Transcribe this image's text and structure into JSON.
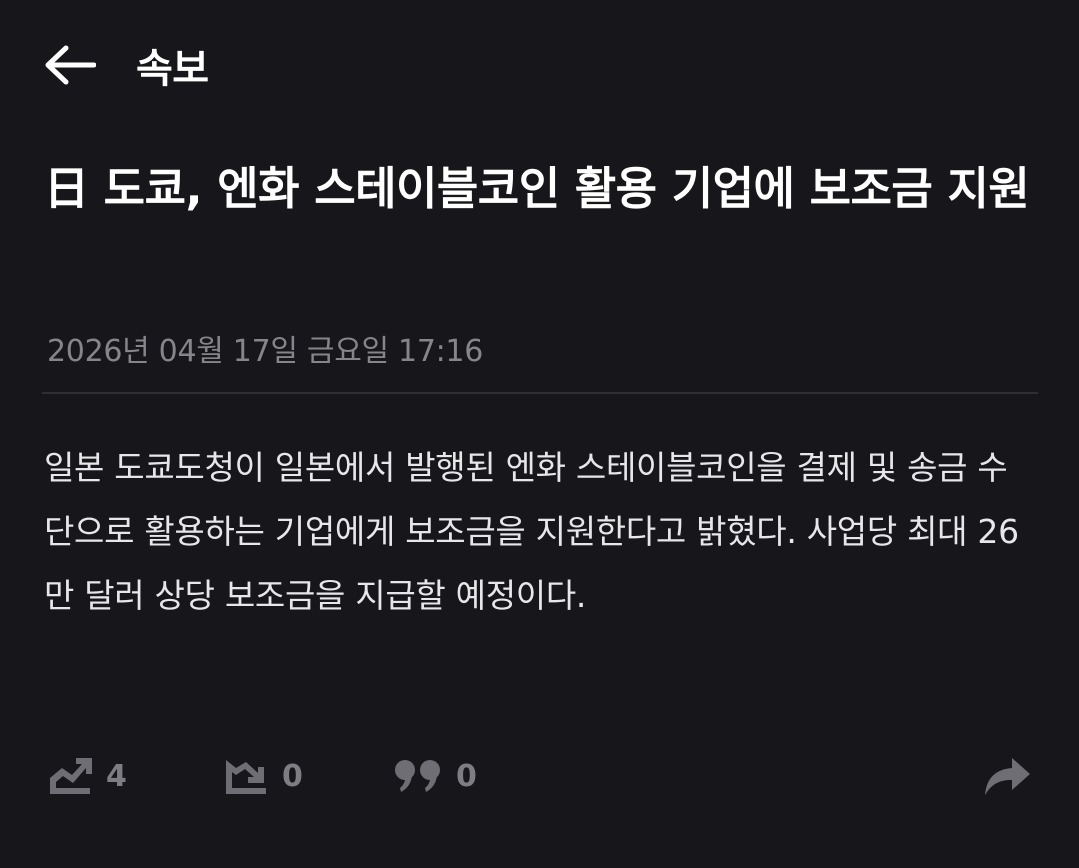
{
  "header": {
    "title": "속보"
  },
  "article": {
    "title": "日 도쿄, 엔화 스테이블코인 활용 기업에 보조금 지원",
    "date": "2026년 04월 17일 금요일 17:16",
    "body": "일본 도쿄도청이 일본에서 발행된 엔화 스테이블코인을 결제 및 송금 수단으로 활용하는 기업에게 보조금을 지원한다고 밝혔다. 사업당 최대 26만 달러 상당 보조금을 지급할 예정이다."
  },
  "actions": {
    "bull_count": "4",
    "bear_count": "0",
    "comment_count": "0"
  },
  "icons": {
    "back": "arrow-left-icon",
    "bull": "trend-up-icon",
    "bear": "trend-down-icon",
    "comment": "quote-icon",
    "share": "share-arrow-icon"
  },
  "colors": {
    "background": "#17171b",
    "text": "#ffffff",
    "muted": "#85858b",
    "icon": "#6e6e74"
  }
}
